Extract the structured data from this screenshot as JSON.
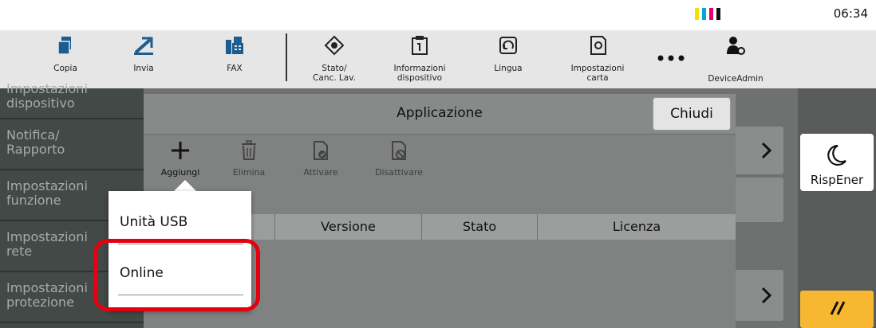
{
  "status": {
    "time": "06:34",
    "ink_colors": [
      "#f1e000",
      "#00a6e0",
      "#e0006a",
      "#111111"
    ]
  },
  "toolbar": {
    "items": [
      {
        "label": "Copia",
        "icon": "copy-icon"
      },
      {
        "label": "Invia",
        "icon": "send-icon"
      },
      {
        "label": "FAX",
        "icon": "fax-icon"
      },
      {
        "label": "Stato/\nCanc. Lav.",
        "icon": "job-status-icon"
      },
      {
        "label": "Informazioni\ndispositivo",
        "icon": "device-info-icon"
      },
      {
        "label": "Lingua",
        "icon": "language-icon"
      },
      {
        "label": "Impostazioni\ncarta",
        "icon": "paper-settings-icon"
      },
      {
        "label": "",
        "icon": "more-icon"
      },
      {
        "label": "DeviceAdmin",
        "icon": "admin-user-icon"
      }
    ]
  },
  "background_menu": {
    "items": [
      "Impostazioni\ndispositivo",
      "Notifica/\nRapporto",
      "Impostazioni\nfunzione",
      "Impostazioni\nrete",
      "Impostazioni\nprotezione"
    ]
  },
  "dialog": {
    "title": "Applicazione",
    "close_label": "Chiudi",
    "actions": [
      {
        "label": "Aggiungi",
        "icon": "plus-icon",
        "enabled": true
      },
      {
        "label": "Elimina",
        "icon": "trash-icon",
        "enabled": false
      },
      {
        "label": "Attivare",
        "icon": "activate-icon",
        "enabled": false
      },
      {
        "label": "Disattivare",
        "icon": "deactivate-icon",
        "enabled": false
      }
    ],
    "table_headers": [
      "",
      "Versione",
      "Stato",
      "Licenza"
    ]
  },
  "popup": {
    "items": [
      "Unità USB",
      "Online"
    ],
    "highlighted": "Online",
    "highlight_color": "#e3000f"
  },
  "right_panel": {
    "sleep_label": "RispEner",
    "reset_color": "#f7b731"
  }
}
